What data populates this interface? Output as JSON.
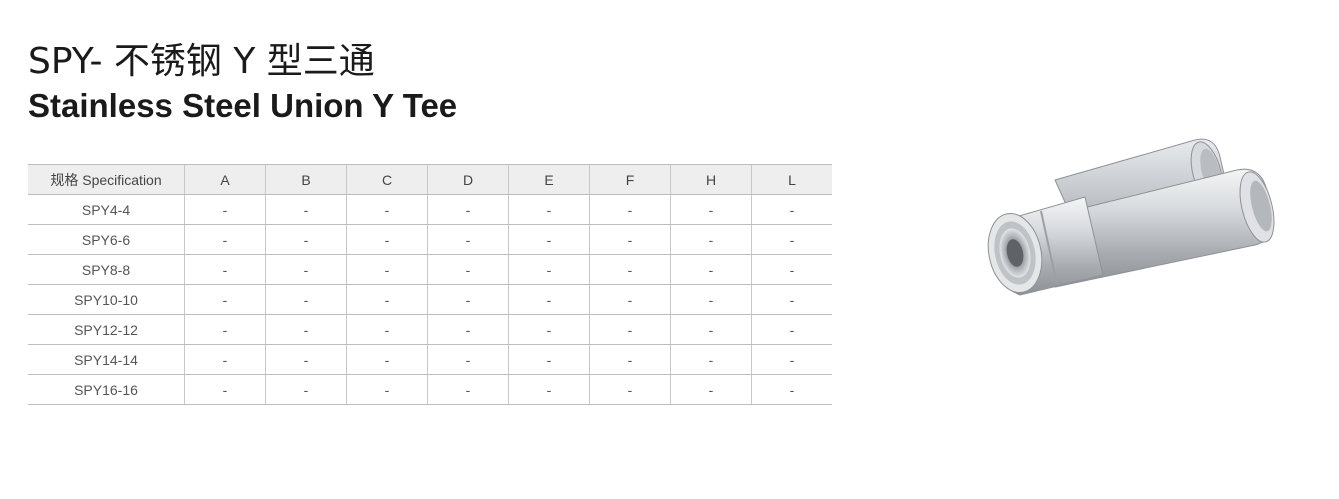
{
  "title": {
    "cn": "SPY- 不锈钢 Y 型三通",
    "en": "Stainless Steel Union Y Tee"
  },
  "table": {
    "headers": [
      "规格 Specification",
      "A",
      "B",
      "C",
      "D",
      "E",
      "F",
      "H",
      "L"
    ],
    "rows": [
      [
        "SPY4-4",
        "-",
        "-",
        "-",
        "-",
        "-",
        "-",
        "-",
        "-"
      ],
      [
        "SPY6-6",
        "-",
        "-",
        "-",
        "-",
        "-",
        "-",
        "-",
        "-"
      ],
      [
        "SPY8-8",
        "-",
        "-",
        "-",
        "-",
        "-",
        "-",
        "-",
        "-"
      ],
      [
        "SPY10-10",
        "-",
        "-",
        "-",
        "-",
        "-",
        "-",
        "-",
        "-"
      ],
      [
        "SPY12-12",
        "-",
        "-",
        "-",
        "-",
        "-",
        "-",
        "-",
        "-"
      ],
      [
        "SPY14-14",
        "-",
        "-",
        "-",
        "-",
        "-",
        "-",
        "-",
        "-"
      ],
      [
        "SPY16-16",
        "-",
        "-",
        "-",
        "-",
        "-",
        "-",
        "-",
        "-"
      ]
    ]
  },
  "colors": {
    "header_bg": "#eeeeee",
    "rule": "#bdbdbd",
    "metal": "#c9ccd0"
  },
  "product_image": {
    "icon": "y-tee-fitting-icon"
  }
}
